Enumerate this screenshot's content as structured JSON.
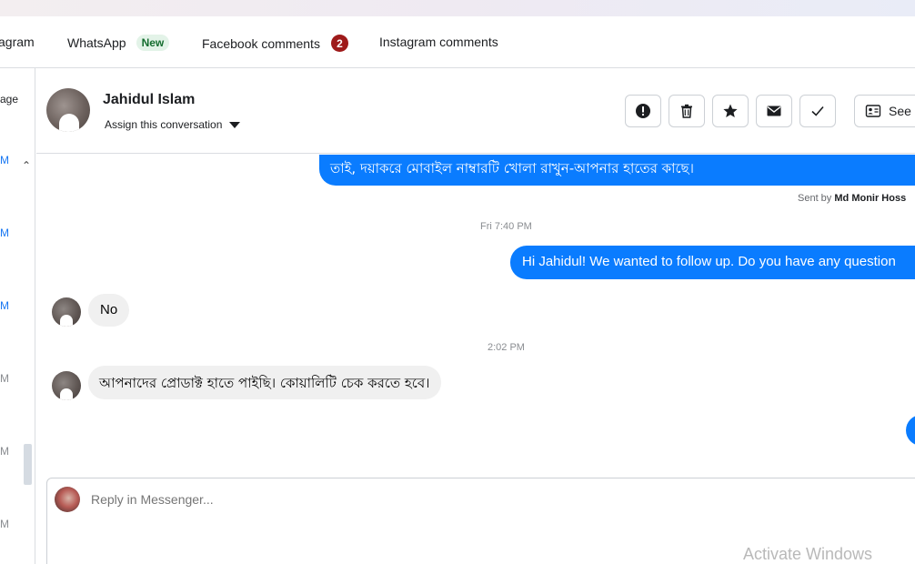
{
  "tabs": [
    {
      "label": "agram"
    },
    {
      "label": "WhatsApp",
      "badge": "New"
    },
    {
      "label": "Facebook comments",
      "badge": "2"
    },
    {
      "label": "Instagram comments"
    }
  ],
  "left_rail": {
    "page_label": "age",
    "times": [
      "M",
      "M",
      "M",
      "M",
      "M",
      "M"
    ]
  },
  "header": {
    "contact_name": "Jahidul Islam",
    "assign_label": "Assign this conversation",
    "see_label": "See c"
  },
  "messages": {
    "top_bubble_line1": "...",
    "top_bubble_line2": "তাই, দয়াকরে মোবাইল নাম্বারটি খোলা রাখুন-আপনার হাতের কাছে।",
    "sent_by_prefix": "Sent by",
    "sent_by_name": "Md Monir Hoss",
    "timestamp_1": "Fri 7:40 PM",
    "follow_up": "Hi Jahidul! We wanted to follow up. Do you have any question",
    "reply_no": "No",
    "timestamp_2": "2:02 PM",
    "bangla_reply": "আপনাদের প্রোডাক্ট হাতে পাইছি। কোয়ালিটি চেক করতে হবে।"
  },
  "composer": {
    "placeholder": "Reply in Messenger..."
  },
  "watermark": "Activate Windows",
  "colors": {
    "accent": "#0a7cff",
    "badge_red": "#9e1a1a",
    "badge_new_bg": "#e3f3e8"
  }
}
